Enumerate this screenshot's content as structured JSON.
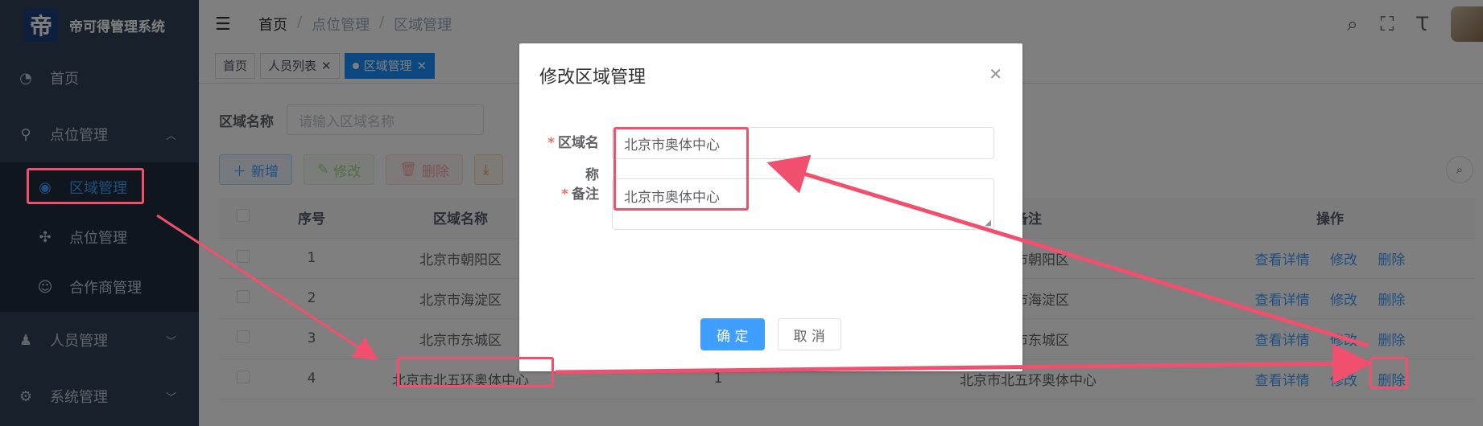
{
  "app": {
    "logo_char": "帝",
    "title": "帝可得管理系统"
  },
  "sidebar": {
    "items": [
      {
        "label": "首页",
        "icon": "dashboard-icon"
      },
      {
        "label": "点位管理",
        "icon": "location-icon",
        "expanded": true,
        "children": [
          {
            "label": "区域管理",
            "icon": "globe-icon",
            "active": true
          },
          {
            "label": "点位管理",
            "icon": "compass-icon"
          },
          {
            "label": "合作商管理",
            "icon": "partner-icon"
          }
        ]
      },
      {
        "label": "人员管理",
        "icon": "people-icon"
      },
      {
        "label": "系统管理",
        "icon": "gear-icon"
      }
    ]
  },
  "navbar": {
    "breadcrumb": [
      "首页",
      "点位管理",
      "区域管理"
    ]
  },
  "tags": [
    {
      "label": "首页"
    },
    {
      "label": "人员列表"
    },
    {
      "label": "区域管理",
      "active": true
    }
  ],
  "search": {
    "label": "区域名称",
    "placeholder": "请输入区域名称"
  },
  "toolbar": {
    "add": "新增",
    "edit": "修改",
    "delete": "删除"
  },
  "table": {
    "headers": [
      "序号",
      "区域名称",
      "备注",
      "操作"
    ],
    "rows": [
      {
        "index": "1",
        "name": "北京市朝阳区",
        "note": "北京市朝阳区"
      },
      {
        "index": "2",
        "name": "北京市海淀区",
        "note": "北京市海淀区"
      },
      {
        "index": "3",
        "name": "北京市东城区",
        "note": "北京市东城区"
      },
      {
        "index": "4",
        "name": "北京市北五环奥体中心",
        "count": "1",
        "note": "北京市北五环奥体中心"
      }
    ],
    "ops": {
      "detail": "查看详情",
      "edit": "修改",
      "delete": "删除"
    }
  },
  "dialog": {
    "title": "修改区域管理",
    "fields": {
      "name_label": "区域名称",
      "name_value": "北京市奥体中心",
      "note_label": "备注",
      "note_value": "北京市奥体中心"
    },
    "confirm": "确 定",
    "cancel": "取 消"
  },
  "colors": {
    "sidebar_bg": "#304156",
    "primary": "#409eff",
    "annotation": "#f0506e"
  }
}
